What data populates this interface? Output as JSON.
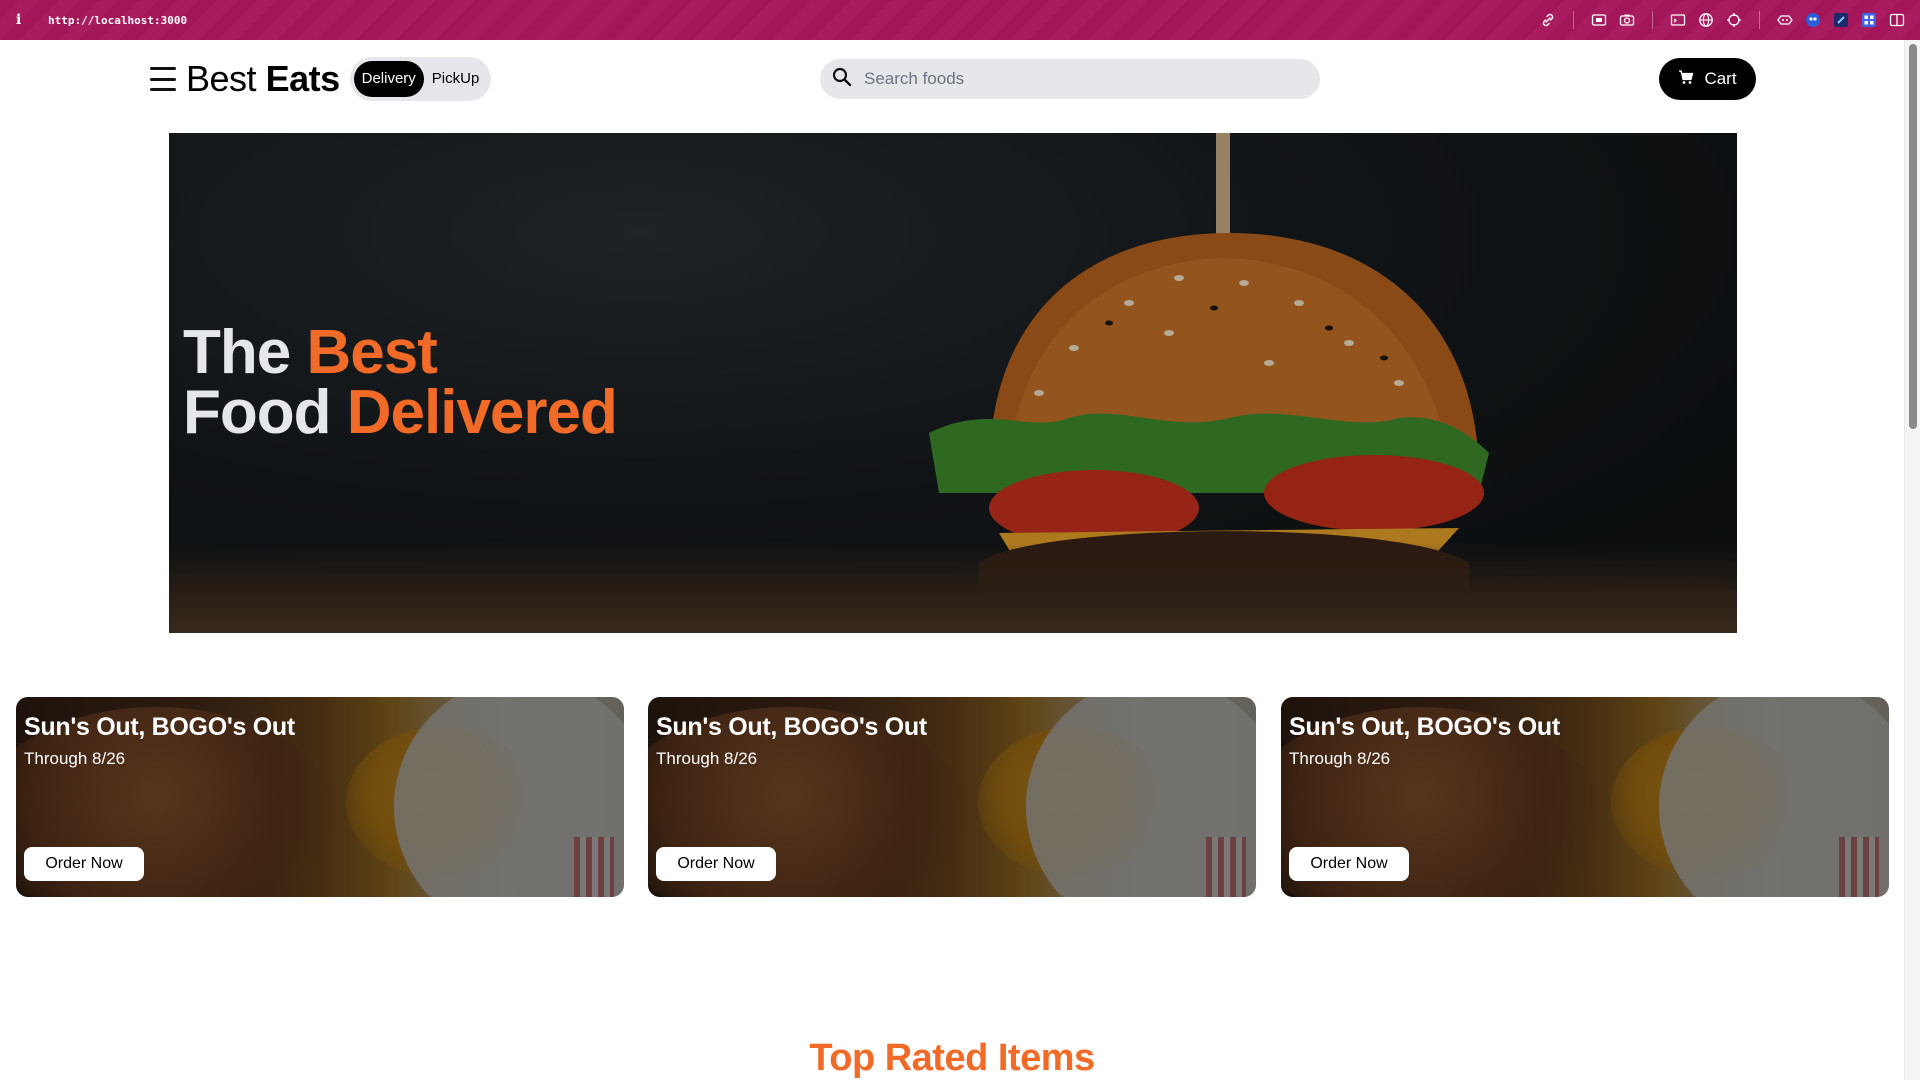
{
  "browser": {
    "info_glyph": "i",
    "url": "http://localhost:3000"
  },
  "nav": {
    "brand_light": "Best",
    "brand_bold": "Eats",
    "delivery_options": [
      "Delivery",
      "PickUp"
    ],
    "delivery_selected": "Delivery",
    "search_placeholder": "Search foods",
    "search_value": "",
    "cart_label": "Cart"
  },
  "hero": {
    "line1_plain": "The",
    "line1_accent": "Best",
    "line2_plain": "Food",
    "line2_accent": "Delivered"
  },
  "promos": [
    {
      "title": "Sun's Out, BOGO's Out",
      "subtitle": "Through 8/26",
      "button": "Order Now"
    },
    {
      "title": "Sun's Out, BOGO's Out",
      "subtitle": "Through 8/26",
      "button": "Order Now"
    },
    {
      "title": "Sun's Out, BOGO's Out",
      "subtitle": "Through 8/26",
      "button": "Order Now"
    }
  ],
  "sections": {
    "top_rated_title": "Top Rated Items"
  },
  "colors": {
    "accent": "#f16a27",
    "devbar": "#a3175a",
    "button_dark": "#000000",
    "pill_bg": "#e5e7eb"
  },
  "icons": [
    "menu-icon",
    "search-icon",
    "cart-icon",
    "link-icon",
    "screenshot-icon",
    "camera-icon",
    "window-icon",
    "globe-icon",
    "crosshair-icon",
    "extension-icon",
    "ghost-icon",
    "bookmark-icon",
    "grid-icon",
    "sidebar-icon"
  ]
}
